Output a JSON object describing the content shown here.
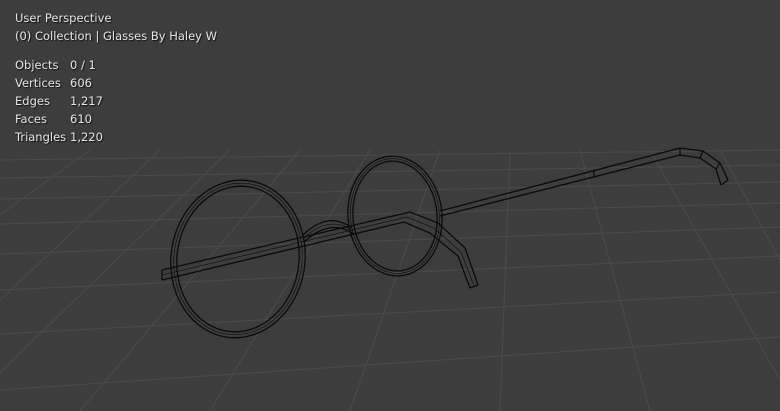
{
  "viewport": {
    "view_name": "User Perspective",
    "collection_info": "(0) Collection | Glasses By Haley W",
    "background_color": "#3d3d3d",
    "grid_color": "#4a4a4a",
    "wire_color": "#000000"
  },
  "stats": [
    {
      "label": "Objects",
      "value": "0 / 1"
    },
    {
      "label": "Vertices",
      "value": "606"
    },
    {
      "label": "Edges",
      "value": "1,217"
    },
    {
      "label": "Faces",
      "value": "610"
    },
    {
      "label": "Triangles",
      "value": "1,220"
    }
  ]
}
